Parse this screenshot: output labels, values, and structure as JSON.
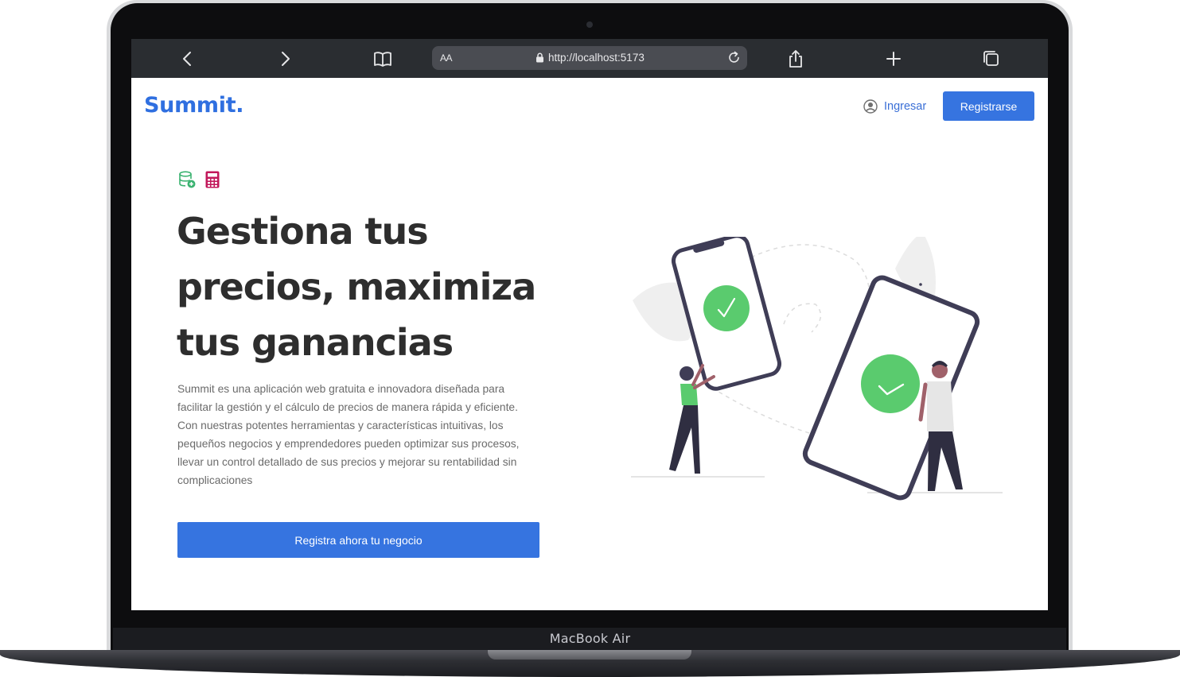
{
  "device": {
    "label": "MacBook Air"
  },
  "browser": {
    "aa_label": "AA",
    "url": "http://localhost:5173",
    "icons": [
      "back-icon",
      "forward-icon",
      "bookmarks-icon",
      "lock-icon",
      "reload-icon",
      "share-icon",
      "new-tab-icon",
      "tabs-icon"
    ]
  },
  "header": {
    "logo": "Summit.",
    "login_label": "Ingresar",
    "register_label": "Registrarse"
  },
  "hero": {
    "icons": [
      "database-add-icon",
      "calculator-icon"
    ],
    "title_lines": [
      "Gestiona tus",
      "precios, maximiza",
      "tus ganancias"
    ],
    "description": "Summit es una aplicación web gratuita e innovadora diseñada para facilitar la gestión y el cálculo de precios de manera rápida y eficiente. Con nuestras potentes herramientas y características intuitivas, los pequeños negocios y emprendedores pueden optimizar sus procesos, llevar un control detallado de sus precios y mejorar su rentabilidad sin complicaciones",
    "cta_label": "Registra ahora tu negocio"
  },
  "colors": {
    "accent": "#3674e0",
    "logo": "#2f6fe0",
    "check_green": "#5acb6e",
    "device_outline": "#3f3d56",
    "database_icon": "#3cb371",
    "calculator_icon": "#c2185b"
  }
}
